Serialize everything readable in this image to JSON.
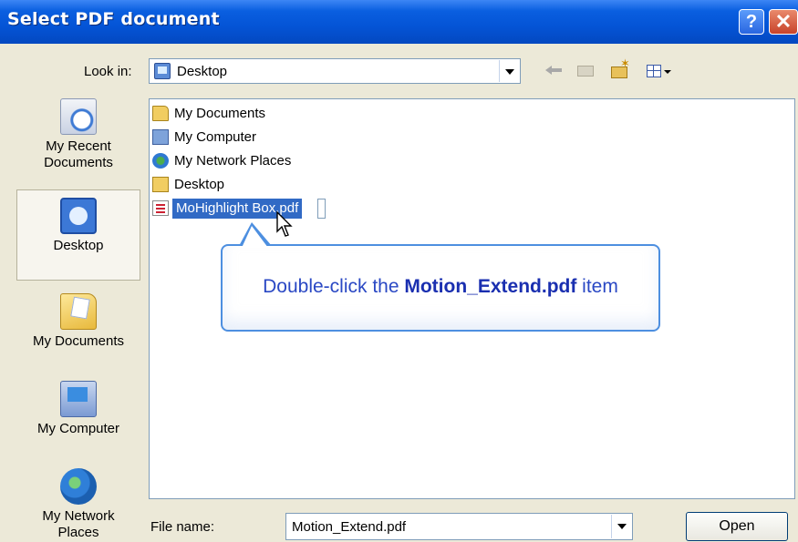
{
  "window": {
    "title": "Select PDF document",
    "help_button": "?",
    "close_button": "✕"
  },
  "toolbar": {
    "look_in_label": "Look in:",
    "look_in_value": "Desktop",
    "icons": [
      "back-icon",
      "up-folder-icon",
      "new-folder-icon",
      "views-menu-icon"
    ]
  },
  "places": [
    {
      "label": "My Recent\nDocuments",
      "icon": "recent-documents-icon"
    },
    {
      "label": "Desktop",
      "icon": "desktop-icon",
      "selected": true
    },
    {
      "label": "My Documents",
      "icon": "my-documents-icon"
    },
    {
      "label": "My Computer",
      "icon": "my-computer-icon"
    },
    {
      "label": "My Network\nPlaces",
      "icon": "network-places-icon"
    }
  ],
  "files": [
    {
      "label": "My Documents",
      "icon": "folder-documents-icon"
    },
    {
      "label": "My Computer",
      "icon": "computer-icon"
    },
    {
      "label": "My Network Places",
      "icon": "network-icon"
    },
    {
      "label": "Desktop",
      "icon": "folder-icon"
    },
    {
      "label": "MoHighlight Box.pdf",
      "icon": "pdf-icon",
      "selected": true
    }
  ],
  "callout": {
    "prefix": "Double-click the ",
    "target": "Motion_Extend.pdf",
    "suffix": " item"
  },
  "bottom": {
    "file_name_label": "File name:",
    "file_name_value": "Motion_Extend.pdf",
    "open_button": "Open"
  },
  "colors": {
    "titlebar": "#0454d6",
    "selection": "#316ac5",
    "callout_border": "#4d8fe0",
    "callout_text": "#2a48c4"
  }
}
